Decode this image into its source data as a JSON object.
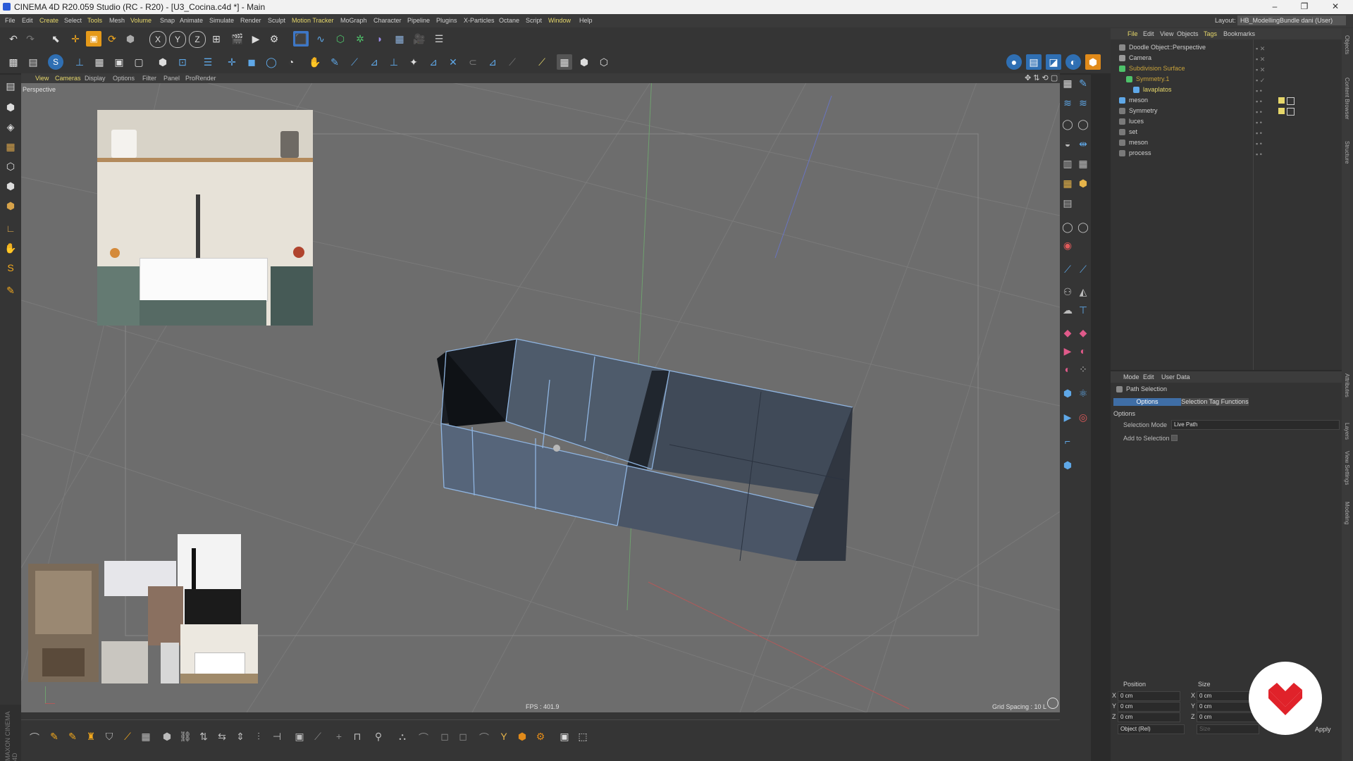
{
  "window": {
    "title": "CINEMA 4D R20.059 Studio (RC - R20) - [U3_Cocina.c4d *] - Main",
    "controls": [
      "–",
      "❐",
      "✕"
    ]
  },
  "menubar": {
    "items": [
      "File",
      "Edit",
      "Create",
      "Select",
      "Tools",
      "Mesh",
      "Volume",
      "Snap",
      "Animate",
      "Simulate",
      "Render",
      "Sculpt",
      "Motion Tracker",
      "MoGraph",
      "Character",
      "Pipeline",
      "Plugins",
      "X-Particles",
      "Octane",
      "Script",
      "Window",
      "Help"
    ],
    "layout_label": "Layout:",
    "layout_value": "HB_ModellingBundle dani (User)"
  },
  "viewport": {
    "menu": [
      "View",
      "Cameras",
      "Display",
      "Options",
      "Filter",
      "Panel",
      "ProRender"
    ],
    "camera_label": "Perspective",
    "fps": "FPS : 401.9",
    "grid_spacing": "Grid Spacing : 10 L"
  },
  "objects_panel": {
    "menu": [
      "File",
      "Edit",
      "View",
      "Objects",
      "Tags",
      "Bookmarks"
    ],
    "rows": [
      {
        "name": "Doodle Object::Perspective",
        "indent": 0,
        "color": "#cfcfcf"
      },
      {
        "name": "Camera",
        "indent": 0,
        "color": "#cfcfcf"
      },
      {
        "name": "Subdivision Surface",
        "indent": 0,
        "color": "#c8a23a"
      },
      {
        "name": "Symmetry.1",
        "indent": 1,
        "color": "#c8a23a"
      },
      {
        "name": "lavaplatos",
        "indent": 2,
        "color": "#e6d76a"
      },
      {
        "name": "meson",
        "indent": 0,
        "color": "#cfcfcf"
      },
      {
        "name": "Symmetry",
        "indent": 0,
        "color": "#cfcfcf"
      },
      {
        "name": "luces",
        "indent": 0,
        "color": "#cfcfcf"
      },
      {
        "name": "set",
        "indent": 0,
        "color": "#cfcfcf"
      },
      {
        "name": "meson",
        "indent": 0,
        "color": "#cfcfcf"
      },
      {
        "name": "process",
        "indent": 0,
        "color": "#cfcfcf"
      }
    ]
  },
  "attributes_panel": {
    "menu": [
      "Mode",
      "Edit",
      "User Data"
    ],
    "title": "Path Selection",
    "tabs": [
      "Options",
      "Selection Tag Functions"
    ],
    "active_tab": "Options",
    "section": "Options",
    "selection_mode_label": "Selection Mode",
    "selection_mode_value": "Live Path",
    "add_to_selection_label": "Add to Selection"
  },
  "coordinates_panel": {
    "headers": [
      "Position",
      "Size"
    ],
    "rows": [
      {
        "axis": "X",
        "pos": "0 cm",
        "size_axis": "X",
        "size": "0 cm"
      },
      {
        "axis": "Y",
        "pos": "0 cm",
        "size_axis": "Y",
        "size": "0 cm"
      },
      {
        "axis": "Z",
        "pos": "0 cm",
        "size_axis": "Z",
        "size": "0 cm"
      }
    ],
    "mode_value": "Object (Rel)",
    "size_value": "Size",
    "apply_label": "Apply"
  },
  "side_tabs": [
    "Objects",
    "Content Browser",
    "Structure",
    "Attributes",
    "Layers",
    "View Settings",
    "Modeling"
  ],
  "branding": {
    "vertical_logo": "MAXON CINEMA 4D"
  },
  "colors": {
    "accent": "#e6d76a",
    "viewport_bg": "#6d6d6d",
    "selection_edge": "#8fb4e0",
    "active_tab": "#3f6ea6",
    "badge_red": "#e0222a"
  },
  "icons": {
    "top_toolbar_1": [
      "undo-icon",
      "redo-icon",
      "move-select-icon",
      "move-icon",
      "scale-icon",
      "rotate-icon",
      "last-tool-icon",
      "x-axis-icon",
      "y-axis-icon",
      "z-axis-icon",
      "world-coords-icon",
      "render-view-icon",
      "render-picture-viewer-icon",
      "edit-render-settings-icon",
      "cube-icon",
      "pen-spline-icon",
      "subdivision-icon",
      "cloner-icon",
      "deformer-icon",
      "floor-icon",
      "camera-icon",
      "light-icon"
    ],
    "top_toolbar_2": [
      "model-mode-icon",
      "texture-mode-icon",
      "workplane-icon",
      "points-mode-icon",
      "edges-mode-icon",
      "polygons-mode-icon",
      "uv-mode-icon",
      "live-selection-icon",
      "loop-selection-icon",
      "move-tool-icon",
      "scale-tool-icon",
      "rotate-tool-icon",
      "polygon-pen-icon",
      "knife-icon",
      "extrude-icon",
      "bevel-icon",
      "bridge-icon",
      "weld-icon",
      "dissolve-icon",
      "melt-icon",
      "slide-icon",
      "iron-icon",
      "magnet-icon",
      "brush-icon",
      "snapping-icon",
      "quantize-icon",
      "grid-icon"
    ]
  }
}
